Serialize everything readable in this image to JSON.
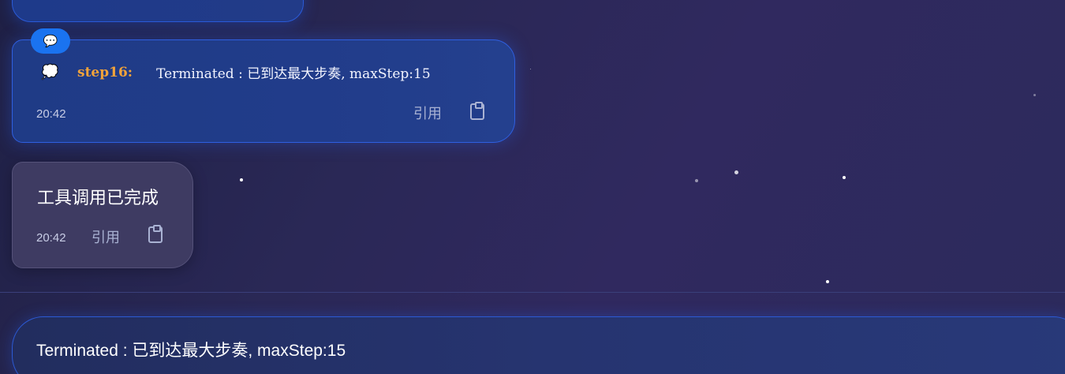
{
  "messages": [
    {
      "badge_icon": "speech-bubble-icon",
      "step_icon": "💭",
      "step_label": "step16:",
      "text": "Terminated : 已到达最大步奏, maxStep:15",
      "time": "20:42",
      "quote_label": "引用",
      "copy_icon": "clipboard-icon"
    },
    {
      "text": "工具调用已完成",
      "time": "20:42",
      "quote_label": "引用",
      "copy_icon": "clipboard-icon"
    }
  ],
  "input": {
    "value": "Terminated : 已到达最大步奏, maxStep:15"
  },
  "colors": {
    "step_label": "#f2a33a",
    "badge": "#1a73f0",
    "blue_bubble": "#213c8a",
    "gray_bubble": "#3e3b62"
  }
}
